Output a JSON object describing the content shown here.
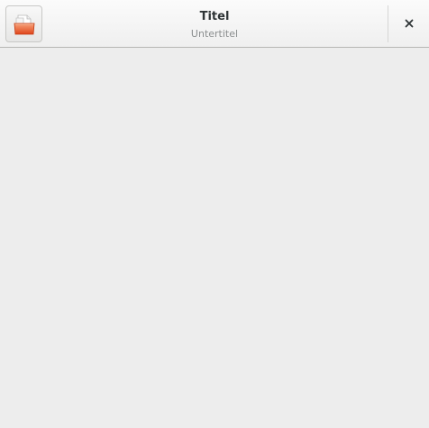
{
  "window": {
    "title": "Titel",
    "subtitle": "Untertitel"
  },
  "icons": {
    "open_button": "folder-open-icon",
    "close_button": "close-icon"
  },
  "colors": {
    "folder_accent": "#e9541f",
    "background": "#ededed"
  }
}
